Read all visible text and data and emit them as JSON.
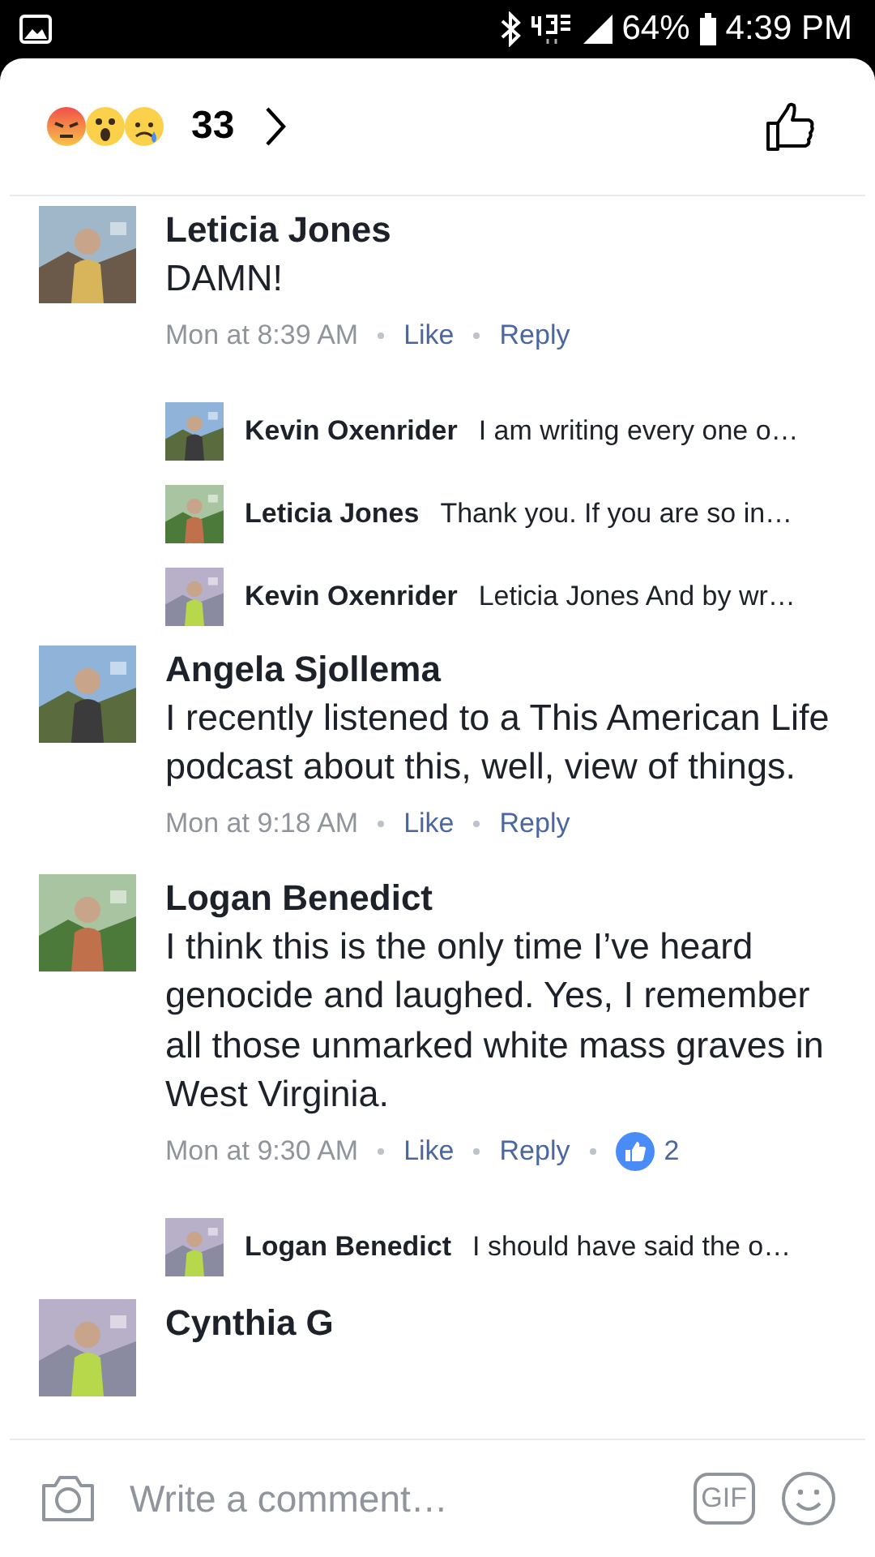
{
  "status_bar": {
    "battery": "64%",
    "time": "4:39 PM"
  },
  "header": {
    "reaction_count": "33"
  },
  "comments": [
    {
      "author": "Leticia Jones",
      "text": "DAMN!",
      "time": "Mon at 8:39 AM",
      "like": "Like",
      "reply": "Reply",
      "replies": [
        {
          "author": "Kevin Oxenrider",
          "text": "I am writing every one o…"
        },
        {
          "author": "Leticia Jones",
          "text": "Thank you. If you are so in…"
        },
        {
          "author": "Kevin Oxenrider",
          "text": "Leticia Jones And by wr…"
        }
      ]
    },
    {
      "author": "Angela Sjollema",
      "text": "I recently listened to a This American Life podcast about this, well, view of things.",
      "time": "Mon at 9:18 AM",
      "like": "Like",
      "reply": "Reply"
    },
    {
      "author": "Logan Benedict",
      "text": "I think this is the only time I’ve heard genocide and laughed. Yes, I remember all those unmarked white mass graves in West Virginia.",
      "time": "Mon at 9:30 AM",
      "like": "Like",
      "reply": "Reply",
      "likes": "2",
      "replies": [
        {
          "author": "Logan Benedict",
          "text": "I should have said the o…"
        }
      ]
    },
    {
      "author": "Cynthia G"
    }
  ],
  "composer": {
    "placeholder": "Write a comment…",
    "gif": "GIF"
  }
}
